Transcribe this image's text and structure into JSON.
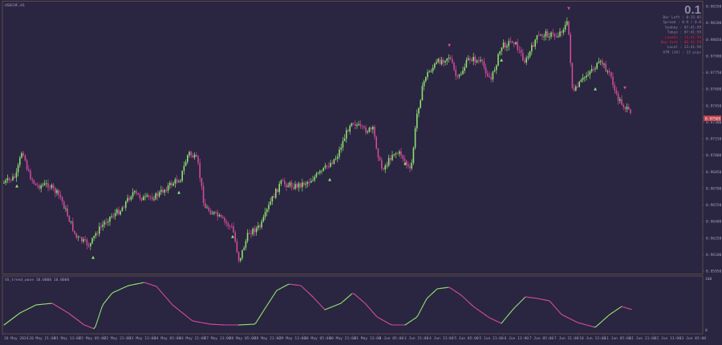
{
  "window": {
    "symbol_title": "USDCHF,H1"
  },
  "info_panel": {
    "big_value": "0.1",
    "lines": [
      {
        "text": "Bar Left : 0:15:05",
        "color": "#8f89a3"
      },
      {
        "text": "Spread : 0.9 / 0.0",
        "color": "#8f89a3"
      },
      {
        "text": "Sydney : 07:41:59",
        "color": "#8f89a3"
      },
      {
        "text": "Tokyo : 07:41:59",
        "color": "#8f89a3"
      },
      {
        "text": "London : 11:41:59",
        "color": "#e0203a"
      },
      {
        "text": "New York : 06:41:59",
        "color": "#e0203a"
      },
      {
        "text": "Local : 23:41:59",
        "color": "#8f89a3"
      },
      {
        "text": "ATR (14) : 13 pips",
        "color": "#8f89a3"
      }
    ]
  },
  "price_axis": {
    "labels": [
      "0.98350",
      "0.98200",
      "0.98050",
      "0.97900",
      "0.97750",
      "0.97600",
      "0.97450",
      "0.97300",
      "0.97150",
      "0.97000",
      "0.96850",
      "0.96700",
      "0.96550",
      "0.96400",
      "0.96250",
      "0.96100",
      "0.95950"
    ],
    "current_price": "0.97565"
  },
  "indicator": {
    "title": "SS_trend_wave 10.0000 10.0000",
    "axis_labels": [
      "100",
      "0"
    ],
    "bull_color": "#8fe070",
    "bear_color": "#d04a9a"
  },
  "time_axis": {
    "labels": [
      "20 May 2024",
      "20 May 21:00",
      "21 May 13:00",
      "22 May 05:00",
      "22 May 21:00",
      "23 May 13:00",
      "24 May 05:00",
      "24 May 21:00",
      "27 May 13:00",
      "28 May 05:00",
      "28 May 21:00",
      "29 May 13:00",
      "30 May 05:00",
      "30 May 21:00",
      "31 May 13:00",
      "3 Jun 05:00",
      "3 Jun 21:00",
      "4 Jun 13:00",
      "5 Jun 05:00",
      "5 Jun 21:00",
      "6 Jun 13:00",
      "7 Jun 05:00",
      "7 Jun 21:00",
      "10 Jun 13:00",
      "11 Jun 05:00",
      "11 Jun 21:00",
      "12 Jun 13:00",
      "13 Jun 05:00"
    ]
  },
  "colors": {
    "background": "#2a2540",
    "frame": "#5a4c4c",
    "bull_candle": "#8fe070",
    "bear_candle": "#d04a9a",
    "arrow_up": "#8fe070",
    "arrow_down": "#d04a9a",
    "current_price_box": "#c0444e"
  },
  "icons": [
    "up-arrow-marker-icon",
    "down-arrow-marker-icon"
  ]
}
